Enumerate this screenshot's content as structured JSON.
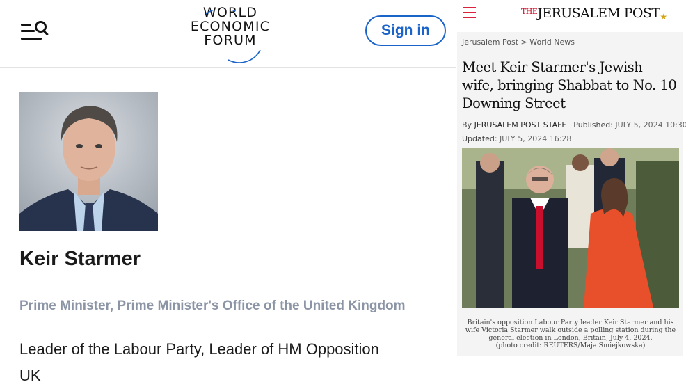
{
  "wef": {
    "logo_lines": [
      "WORLD",
      "ECONOMIC",
      "FORUM"
    ],
    "signin_label": "Sign in",
    "person": {
      "name": "Keir Starmer",
      "role": "Prime Minister, Prime Minister's Office of the United Kingdom",
      "description_line1": "Leader of the Labour Party, Leader of HM Opposition",
      "description_line2": "UK"
    },
    "accent_color": "#1a63c9"
  },
  "jpost": {
    "logo_the": "THE",
    "logo_name": "JERUSALEM POST",
    "breadcrumb": [
      "Jerusalem Post",
      "World News"
    ],
    "breadcrumb_sep": ">",
    "headline": "Meet Keir Starmer's Jewish wife, bringing Shabbat to No. 10 Downing Street",
    "byline_label": "By",
    "byline_author": "JERUSALEM POST STAFF",
    "published_label": "Published:",
    "published_value": "JULY 5, 2024 10:30",
    "updated_label": "Updated:",
    "updated_value": "JULY 5, 2024 16:28",
    "caption": "Britain's opposition Labour Party leader Keir Starmer and his wife Victoria Starmer walk outside a polling station during the general election in London, Britain, July 4, 2024.",
    "photo_credit": "(photo credit: REUTERS/Maja Smiejkowska)",
    "accent_color": "#d9233c"
  }
}
